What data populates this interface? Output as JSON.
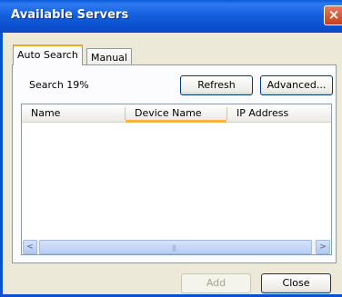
{
  "window": {
    "title": "Available Servers"
  },
  "tabs": [
    {
      "label": "Auto Search",
      "active": true
    },
    {
      "label": "Manual",
      "active": false
    }
  ],
  "search": {
    "status": "Search 19%",
    "progress_percent": 19
  },
  "buttons": {
    "refresh": "Refresh",
    "advanced": "Advanced...",
    "add": "Add",
    "close": "Close"
  },
  "table": {
    "columns": [
      "Name",
      "Device Name",
      "IP Address"
    ],
    "sorted_column": "Device Name",
    "rows": []
  },
  "scrollbar": {
    "left_arrow": "<",
    "right_arrow": ">",
    "grip": "|||"
  },
  "icons": {
    "close": "×"
  },
  "colors": {
    "title_bar": "#0b4fd0",
    "accent": "#f3a42a",
    "close_button": "#c6401c"
  }
}
